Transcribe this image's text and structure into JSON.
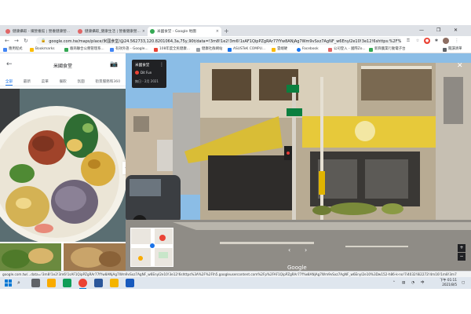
{
  "browser": {
    "tabs": [
      {
        "title": "健康攝取 - 纖營養館 | 營養健康營...",
        "favicon_color": "#e06666",
        "active": false
      },
      {
        "title": "健康攝取_健康生活 | 營養健康營...",
        "favicon_color": "#e06666",
        "active": false
      },
      {
        "title": "米國食堂 - Google 地圖",
        "favicon_color": "#34a853",
        "active": true
      }
    ],
    "new_tab_label": "+",
    "url": "google.com.tw/maps/place/米國食堂/@24.562733,120.8201064,3a,75y,90t/data=!3m8!1e2!3m6!1sAF1QipPZgRAr77fYw8ANjAg7Wm9vSxz7AgNF_w6Enyl2e10!3e12!6shttps:%2F%2Flh...",
    "bookmarks": [
      {
        "label": "應用程式",
        "color": "#4285f4"
      },
      {
        "label": "Bookmarks",
        "color": "#fbbc04"
      },
      {
        "label": "廠商聯合公務管理系...",
        "color": "#34a853"
      },
      {
        "label": "有效外語 - Google...",
        "color": "#4285f4"
      },
      {
        "label": "108年度全民健康...",
        "color": "#ea4335"
      },
      {
        "label": "健康社群網站",
        "color": "#9aa0a6"
      },
      {
        "label": "ASUSTeK COMPU...",
        "color": "#1a73e8"
      },
      {
        "label": "雲端硬",
        "color": "#fbbc04"
      },
      {
        "label": "Facebook",
        "color": "#1877f2"
      },
      {
        "label": "公司登入 - 國際Zo...",
        "color": "#e06666"
      },
      {
        "label": "新興農業行動電子台",
        "color": "#34a853"
      }
    ],
    "reading_list": "閱讀清單"
  },
  "left_panel": {
    "title": "米國食堂",
    "tabs": [
      "全部",
      "最新",
      "菜單",
      "餐飲",
      "氛圍",
      "街景服務和360"
    ],
    "active_tab": 0
  },
  "street_view": {
    "place_name": "米國食堂",
    "author": "Dit Fun",
    "date": "無日 - 2月 2021",
    "storefront_sign": "米國食堂",
    "logo": "Google"
  },
  "status_url": "google.com.tw/...data=!3m8!1e2!3m6!1sAF1QipPZgRAr77fYw8ANjAg7Wm9vSxz7AgNF_w6Enyl2e10!3e12!6shttps%3A%2F%2Flh5.googleusercontent.com%2Fp%2FAF1QipPZgRAr77fYw8ANjAg7Wm9vSxz7AgNF_w6Enyl2e10%3Dw152-h86-k-no!7i4032!8i2272!4m16!1m8!3m7",
  "taskbar": {
    "apps": [
      {
        "name": "task-view",
        "color": "#5f6368"
      },
      {
        "name": "file-explorer",
        "color": "#f9ab00"
      },
      {
        "name": "edge",
        "color": "#0f9d58"
      },
      {
        "name": "chrome",
        "color": "#ea4335"
      },
      {
        "name": "word-2",
        "color": "#2b579a"
      },
      {
        "name": "sticky",
        "color": "#f4b400"
      },
      {
        "name": "word",
        "color": "#185abd"
      }
    ],
    "time": "下午 01:11",
    "date": "2021/8/5"
  }
}
